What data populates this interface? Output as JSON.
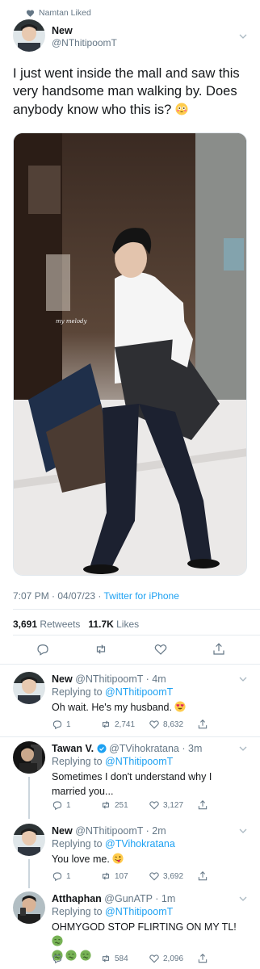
{
  "liked_banner": "Namtan Liked",
  "main_tweet": {
    "name": "New",
    "handle": "@NThitipoomT",
    "text": "I just went inside the mall and saw this very handsome man walking by. Does anybody know who this is?",
    "text_emoji": "flushed-face-emoji",
    "photo_watermark": "my melody",
    "time": "7:07 PM · 04/07/23 · ",
    "source": "Twitter for iPhone",
    "retweets_count": "3,691",
    "retweets_label": "Retweets",
    "likes_count": "11.7K",
    "likes_label": "Likes"
  },
  "replies": [
    {
      "name": "New",
      "handle": "@NThitipoomT · 4m",
      "replying_prefix": "Replying to ",
      "replying_to": "@NThitipoomT",
      "text": "Oh wait. He's my husband.",
      "emoji": "heart-eyes-emoji",
      "replies": "1",
      "retweets": "2,741",
      "likes": "8,632"
    },
    {
      "name": "Tawan V.",
      "handle": "@TVihokratana · 3m",
      "replying_prefix": "Replying to ",
      "replying_to": "@NThitipoomT",
      "text": "Sometimes I don't understand why I married you...",
      "replies": "1",
      "retweets": "251",
      "likes": "3,127"
    },
    {
      "name": "New",
      "handle": "@NThitipoomT · 2m",
      "replying_prefix": "Replying to ",
      "replying_to": "@TVihokratana",
      "text": "You love me.",
      "emoji": "tongue-wink-emoji",
      "replies": "1",
      "retweets": "107",
      "likes": "3,692"
    },
    {
      "name": "Atthaphan",
      "handle": "@GunATP · 1m",
      "replying_prefix": "Replying to ",
      "replying_to": "@NThitipoomT",
      "text": "OHMYGOD STOP FLIRTING ON MY TL!",
      "emoji": "nauseated-face-emoji",
      "retweets": "584",
      "likes": "2,096"
    }
  ],
  "colors": {
    "accent": "#1da1f2",
    "secondary_text": "#657786",
    "divider": "#e6ecf0"
  }
}
